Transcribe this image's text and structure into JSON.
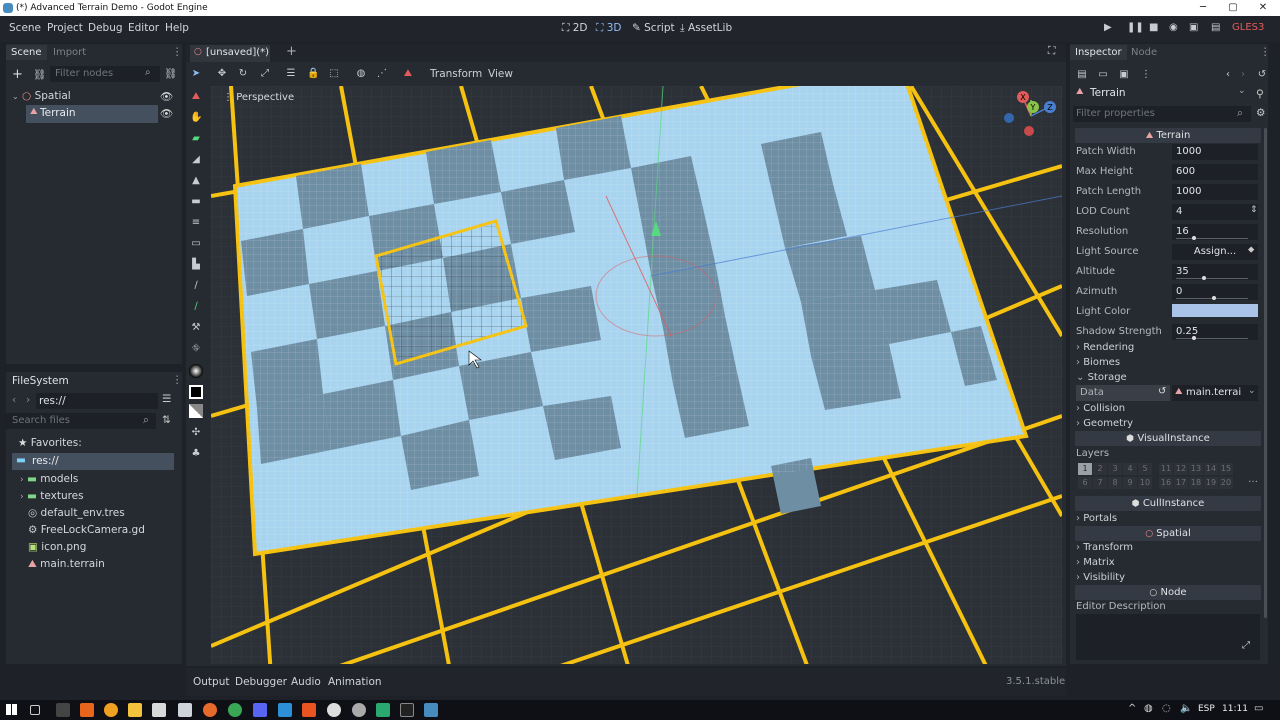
{
  "window": {
    "title": "(*) Advanced Terrain Demo - Godot Engine"
  },
  "menu": [
    "Scene",
    "Project",
    "Debug",
    "Editor",
    "Help"
  ],
  "workspaces": {
    "w2d": "2D",
    "w3d": "3D",
    "script": "Script",
    "assetlib": "AssetLib"
  },
  "renderer": "GLES3",
  "scene_dock": {
    "tab_scene": "Scene",
    "tab_import": "Import",
    "filter_placeholder": "Filter nodes",
    "nodes": [
      {
        "name": "Spatial"
      },
      {
        "name": "Terrain"
      }
    ]
  },
  "filesystem": {
    "title": "FileSystem",
    "path": "res://",
    "search_placeholder": "Search files",
    "favorites": "Favorites:",
    "root": "res://",
    "items": [
      "models",
      "textures",
      "default_env.tres",
      "FreeLockCamera.gd",
      "icon.png",
      "main.terrain"
    ]
  },
  "viewport": {
    "scene_tab": "[unsaved](*)",
    "menu_transform": "Transform",
    "menu_view": "View",
    "perspective": "Perspective",
    "gizmo": {
      "x": "X",
      "y": "Y",
      "z": "Z"
    }
  },
  "bottom": {
    "tabs": [
      "Output",
      "Debugger",
      "Audio",
      "Animation"
    ],
    "version": "3.5.1.stable"
  },
  "inspector": {
    "tab_inspector": "Inspector",
    "tab_node": "Node",
    "object": "Terrain",
    "filter_placeholder": "Filter properties",
    "category_terrain": "Terrain",
    "props": [
      {
        "label": "Patch Width",
        "value": "1000"
      },
      {
        "label": "Max Height",
        "value": "600"
      },
      {
        "label": "Patch Length",
        "value": "1000"
      },
      {
        "label": "LOD Count",
        "value": "4"
      },
      {
        "label": "Resolution",
        "value": "16"
      },
      {
        "label": "Light Source",
        "value": "Assign..."
      },
      {
        "label": "Altitude",
        "value": "35"
      },
      {
        "label": "Azimuth",
        "value": "0"
      }
    ],
    "light_color_label": "Light Color",
    "light_color": "#a9c4e8",
    "shadow_label": "Shadow Strength",
    "shadow_value": "0.25",
    "sections1": [
      "Rendering",
      "Biomes",
      "Storage"
    ],
    "storage_data_label": "Data",
    "storage_data_value": "main.terrai",
    "sections2": [
      "Collision",
      "Geometry"
    ],
    "category_visual": "VisualInstance",
    "layers_label": "Layers",
    "layers_row1": [
      "1",
      "2",
      "3",
      "4",
      "5",
      "11",
      "12",
      "13",
      "14",
      "15"
    ],
    "layers_row2": [
      "6",
      "7",
      "8",
      "9",
      "10",
      "16",
      "17",
      "18",
      "19",
      "20"
    ],
    "category_cull": "CullInstance",
    "portals": "Portals",
    "category_spatial": "Spatial",
    "sections3": [
      "Transform",
      "Matrix",
      "Visibility"
    ],
    "category_node": "Node",
    "editor_description": "Editor Description"
  },
  "taskbar": {
    "lang": "ESP",
    "time": "11:11"
  },
  "colors": {
    "accent": "#699ce8",
    "grid_yellow": "#f5c211",
    "terrain_light": "#a8d4ef",
    "terrain_dark": "#6e8ea4"
  }
}
